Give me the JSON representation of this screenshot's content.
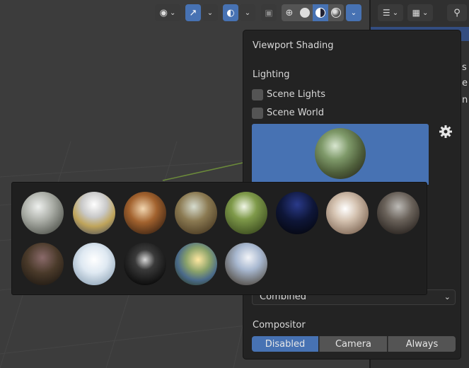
{
  "popover": {
    "title": "Viewport Shading",
    "lighting_label": "Lighting",
    "scene_lights_label": "Scene Lights",
    "scene_world_label": "Scene World",
    "render_pass_value": "Combined",
    "compositor_label": "Compositor",
    "compositor_options": [
      "Disabled",
      "Camera",
      "Always"
    ],
    "compositor_selected": "Disabled"
  },
  "hdri_picker": {
    "items": [
      "studio",
      "courtyard",
      "interior",
      "forest",
      "forest-sunny",
      "night",
      "city",
      "sunset",
      "field-dusk",
      "snow",
      "tunnel",
      "meadow",
      "street"
    ]
  },
  "right_pane_letters": [
    "s",
    "e",
    "n"
  ],
  "colors": {
    "accent": "#4772b3",
    "popover_bg": "#232323",
    "viewport_bg": "#3c3c3c"
  },
  "icons": [
    "eye-icon",
    "gizmo-icon",
    "overlay-icon",
    "xray-icon",
    "wireframe-shading-icon",
    "solid-shading-icon",
    "material-shading-icon",
    "rendered-shading-icon",
    "outliner-icon",
    "image-icon",
    "search-icon",
    "gear-icon"
  ]
}
